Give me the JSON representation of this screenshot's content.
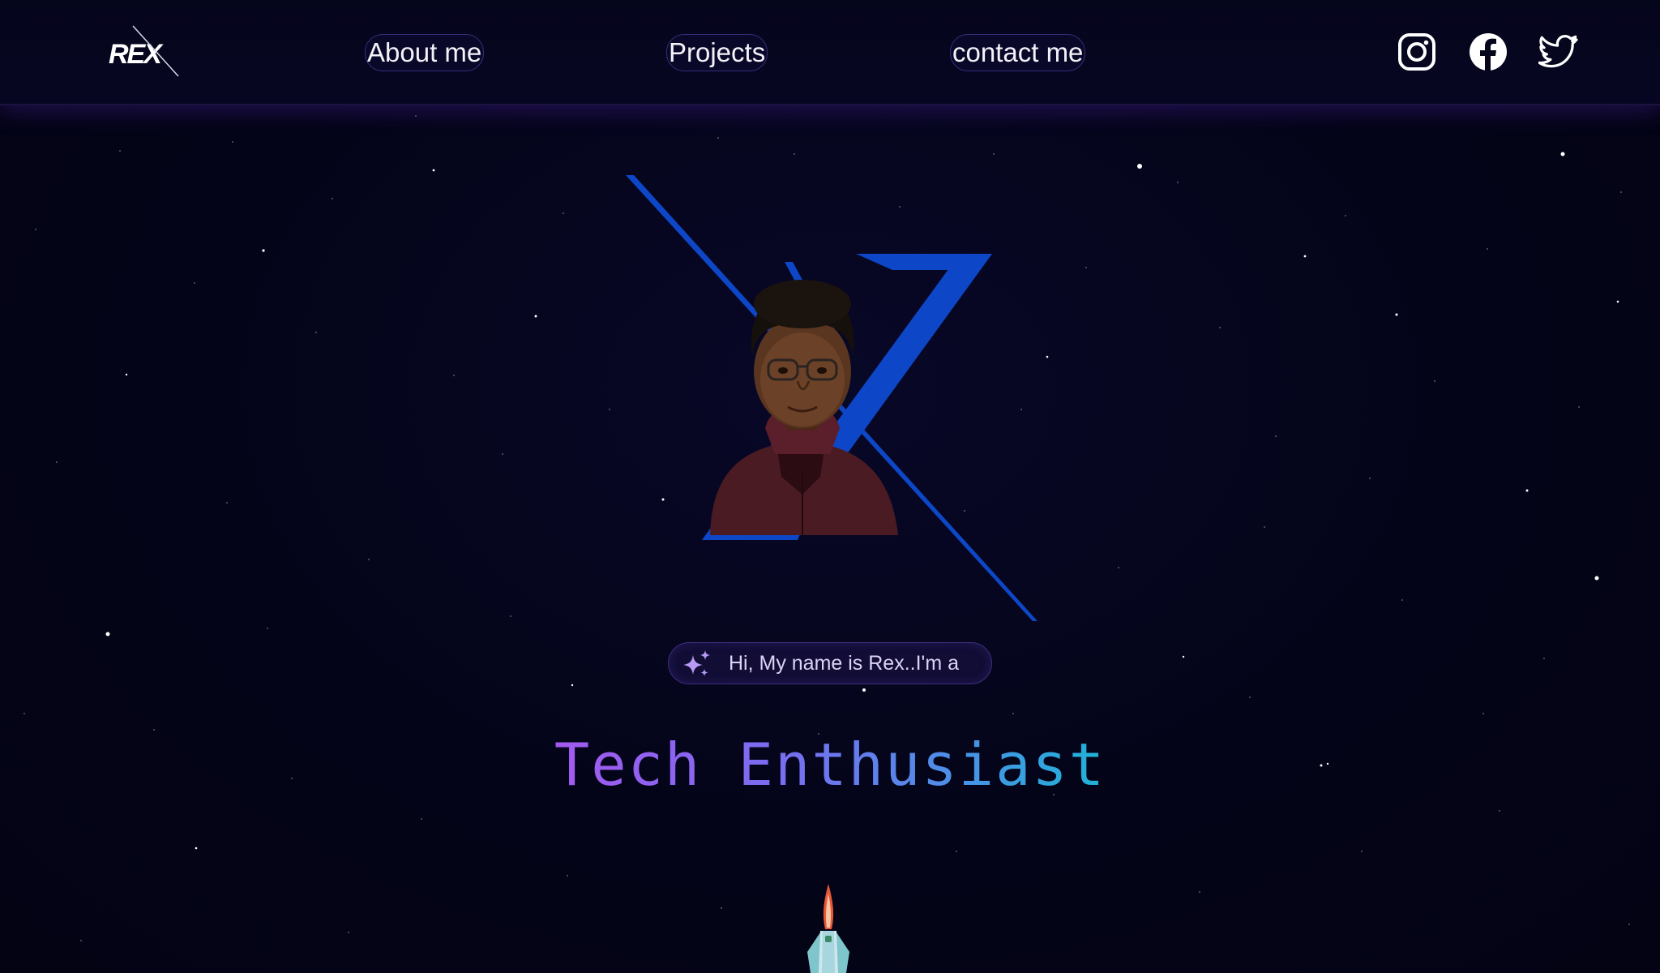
{
  "header": {
    "logo_text": "REX",
    "nav": [
      {
        "label": "About me"
      },
      {
        "label": "Projects"
      },
      {
        "label": "contact me"
      }
    ],
    "social_icons": [
      "instagram-icon",
      "facebook-icon",
      "twitter-icon"
    ]
  },
  "hero": {
    "greeting": "Hi, My name is Rex..I'm a",
    "role": "Tech Enthusiast",
    "sparkle_icon": "sparkles-icon",
    "rocket_icon": "rocket-icon"
  },
  "colors": {
    "background": "#04041a",
    "accent_blue": "#0d47c8",
    "gradient_start": "#a25af0",
    "gradient_end": "#1fb3d6",
    "pill_border": "#3d2e7c"
  }
}
